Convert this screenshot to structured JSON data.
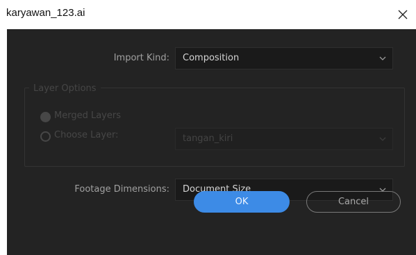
{
  "window": {
    "title": "karyawan_123.ai",
    "close_icon": "close-icon"
  },
  "import_kind": {
    "label": "Import Kind:",
    "value": "Composition",
    "icon": "chevron-down-icon"
  },
  "layer_options": {
    "legend": "Layer Options",
    "merged_label": "Merged Layers",
    "choose_label": "Choose Layer:",
    "layer_value": "tangan_kiri",
    "enabled": false
  },
  "footage_dimensions": {
    "label": "Footage Dimensions:",
    "value": "Document Size",
    "icon": "chevron-down-icon"
  },
  "buttons": {
    "ok": "OK",
    "cancel": "Cancel"
  },
  "colors": {
    "panel": "#232323",
    "accent": "#3d8be6"
  }
}
